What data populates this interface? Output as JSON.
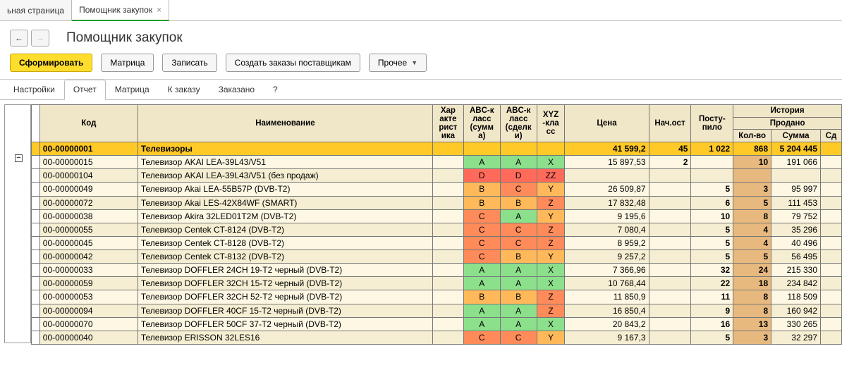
{
  "tabs_top": {
    "t0": "ьная страница",
    "t1": "Помощник закупок"
  },
  "title": "Помощник закупок",
  "toolbar": {
    "form": "Сформировать",
    "matrix": "Матрица",
    "save": "Записать",
    "create_orders": "Создать заказы поставщикам",
    "other": "Прочее"
  },
  "inner_tabs": {
    "settings": "Настройки",
    "report": "Отчет",
    "matrix": "Матрица",
    "to_order": "К заказу",
    "ordered": "Заказано",
    "help": "?"
  },
  "headers": {
    "code": "Код",
    "name": "Наименование",
    "char": "Хар\nакте\nрист\nика",
    "abc_sum": "ABC-к\nласс\n(сумм\nа)",
    "abc_deal": "ABC-к\nласс\n(сделк\nи)",
    "xyz": "XYZ\n-кла\nсс",
    "price": "Цена",
    "nach": "Нач.ост",
    "post": "Посту-\nпило",
    "history": "История",
    "sold": "Продано",
    "kolvo": "Кол-во",
    "summa": "Сумма",
    "sd": "Сд"
  },
  "summary": {
    "code": "00-00000001",
    "name": "Телевизоры",
    "price": "41 599,2",
    "nach": "45",
    "post": "1 022",
    "kolvo": "868",
    "summa": "5 204 445"
  },
  "rows": [
    {
      "code": "00-00000015",
      "name": "Телевизор AKAI LEA-39L43/V51",
      "abc_s": "A",
      "abc_d": "A",
      "xyz": "X",
      "price": "15 897,53",
      "nach": "2",
      "post": "",
      "kolvo": "10",
      "summa": "191 066"
    },
    {
      "code": "00-00000104",
      "name": "Телевизор AKAI LEA-39L43/V51 (без продаж)",
      "abc_s": "D",
      "abc_d": "D",
      "xyz": "ZZ",
      "price": "",
      "nach": "",
      "post": "",
      "kolvo": "",
      "summa": ""
    },
    {
      "code": "00-00000049",
      "name": "Телевизор Akai LEA-55B57P (DVB-T2)",
      "abc_s": "B",
      "abc_d": "C",
      "xyz": "Y",
      "price": "26 509,87",
      "nach": "",
      "post": "5",
      "kolvo": "3",
      "summa": "95 997"
    },
    {
      "code": "00-00000072",
      "name": "Телевизор Akai LES-42X84WF (SMART)",
      "abc_s": "B",
      "abc_d": "B",
      "xyz": "Z",
      "price": "17 832,48",
      "nach": "",
      "post": "6",
      "kolvo": "5",
      "summa": "111 453"
    },
    {
      "code": "00-00000038",
      "name": "Телевизор Akira 32LED01T2M (DVB-T2)",
      "abc_s": "C",
      "abc_d": "A",
      "xyz": "Y",
      "price": "9 195,6",
      "nach": "",
      "post": "10",
      "kolvo": "8",
      "summa": "79 752"
    },
    {
      "code": "00-00000055",
      "name": "Телевизор Centek CT-8124 (DVB-T2)",
      "abc_s": "C",
      "abc_d": "C",
      "xyz": "Z",
      "price": "7 080,4",
      "nach": "",
      "post": "5",
      "kolvo": "4",
      "summa": "35 296"
    },
    {
      "code": "00-00000045",
      "name": "Телевизор Centek CT-8128 (DVB-T2)",
      "abc_s": "C",
      "abc_d": "C",
      "xyz": "Z",
      "price": "8 959,2",
      "nach": "",
      "post": "5",
      "kolvo": "4",
      "summa": "40 496"
    },
    {
      "code": "00-00000042",
      "name": "Телевизор Centek CT-8132 (DVB-T2)",
      "abc_s": "C",
      "abc_d": "B",
      "xyz": "Y",
      "price": "9 257,2",
      "nach": "",
      "post": "5",
      "kolvo": "5",
      "summa": "56 495"
    },
    {
      "code": "00-00000033",
      "name": "Телевизор DOFFLER 24CH 19-T2 черный (DVB-T2)",
      "abc_s": "A",
      "abc_d": "A",
      "xyz": "X",
      "price": "7 366,96",
      "nach": "",
      "post": "32",
      "kolvo": "24",
      "summa": "215 330"
    },
    {
      "code": "00-00000059",
      "name": "Телевизор DOFFLER 32CH 15-T2 черный (DVB-T2)",
      "abc_s": "A",
      "abc_d": "A",
      "xyz": "X",
      "price": "10 768,44",
      "nach": "",
      "post": "22",
      "kolvo": "18",
      "summa": "234 842"
    },
    {
      "code": "00-00000053",
      "name": "Телевизор DOFFLER 32CH 52-T2 черный (DVB-T2)",
      "abc_s": "B",
      "abc_d": "B",
      "xyz": "Z",
      "price": "11 850,9",
      "nach": "",
      "post": "11",
      "kolvo": "8",
      "summa": "118 509"
    },
    {
      "code": "00-00000094",
      "name": "Телевизор DOFFLER 40CF 15-T2 черный (DVB-T2)",
      "abc_s": "A",
      "abc_d": "A",
      "xyz": "Z",
      "price": "16 850,4",
      "nach": "",
      "post": "9",
      "kolvo": "8",
      "summa": "160 942"
    },
    {
      "code": "00-00000070",
      "name": "Телевизор DOFFLER 50CF 37-T2 черный (DVB-T2)",
      "abc_s": "A",
      "abc_d": "A",
      "xyz": "X",
      "price": "20 843,2",
      "nach": "",
      "post": "16",
      "kolvo": "13",
      "summa": "330 265"
    },
    {
      "code": "00-00000040",
      "name": "Телевизор ERISSON 32LES16",
      "abc_s": "C",
      "abc_d": "C",
      "xyz": "Y",
      "price": "9 167,3",
      "nach": "",
      "post": "5",
      "kolvo": "3",
      "summa": "32 297"
    }
  ]
}
